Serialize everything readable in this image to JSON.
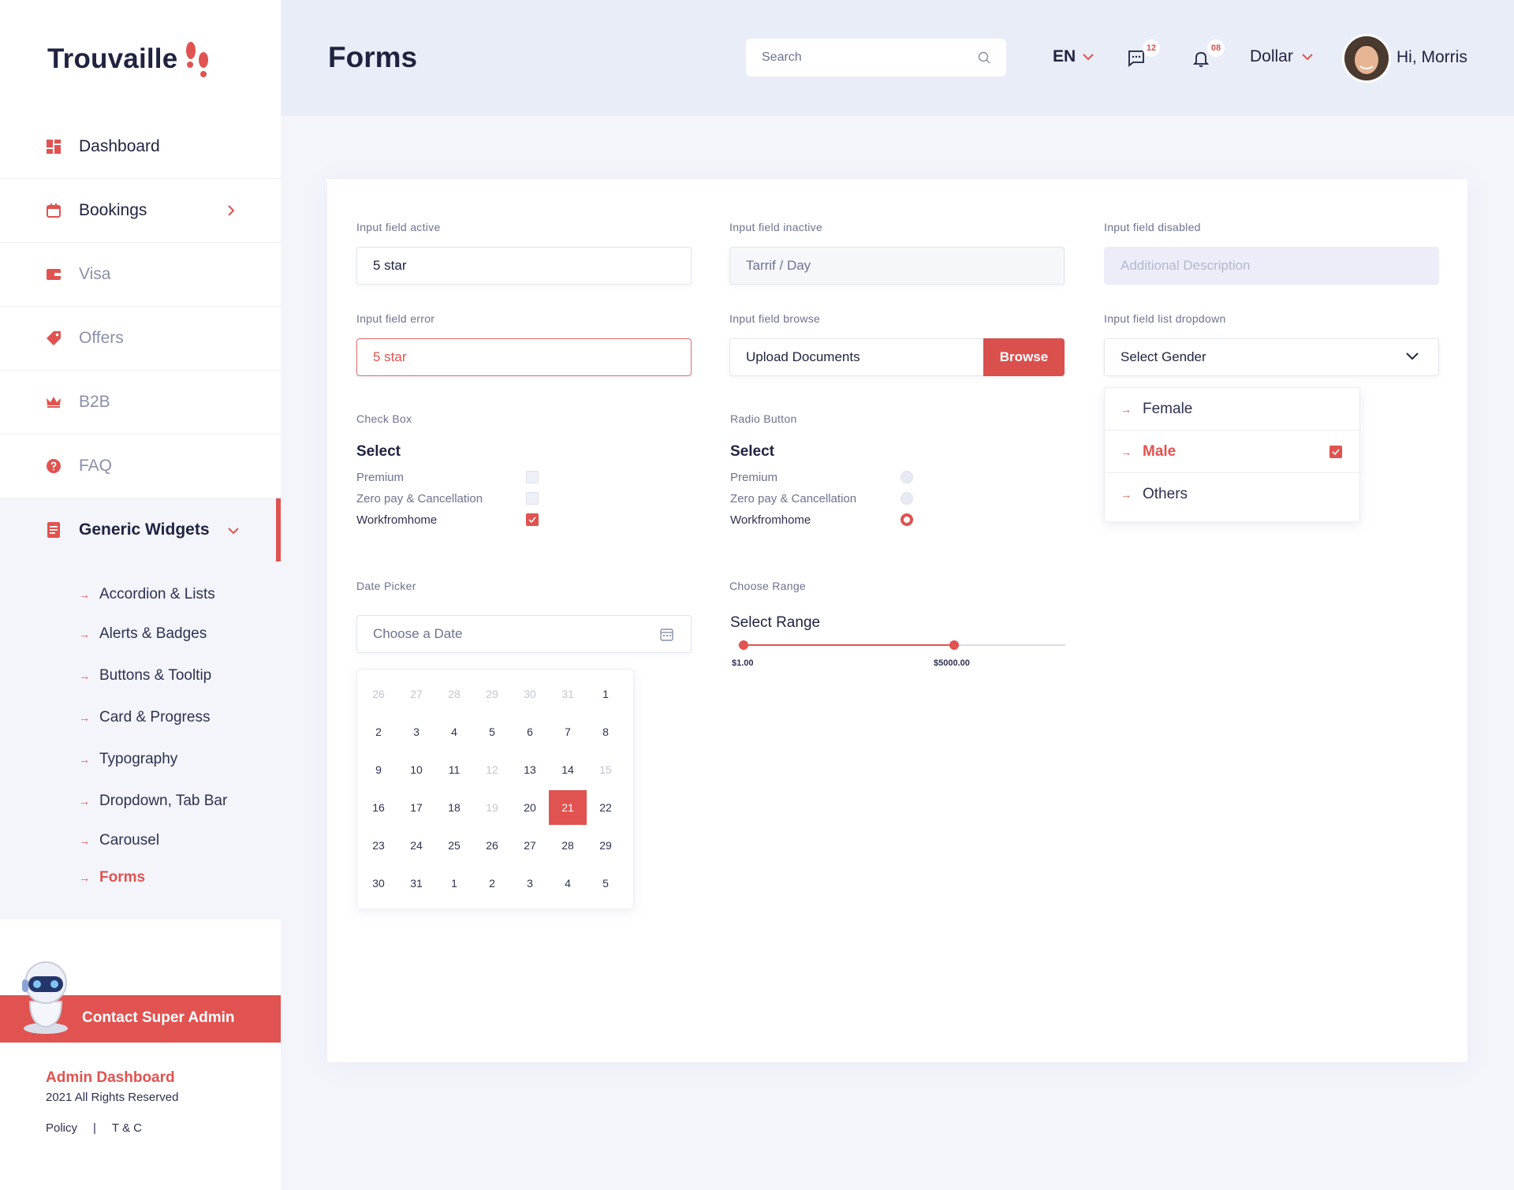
{
  "brand": {
    "name": "Trouvaille",
    "accent": "#e05350"
  },
  "sidebar": {
    "items": [
      {
        "label": "Dashboard",
        "icon": "dashboard-icon"
      },
      {
        "label": "Bookings",
        "icon": "calendar-icon"
      },
      {
        "label": "Visa",
        "icon": "wallet-icon"
      },
      {
        "label": "Offers",
        "icon": "tag-icon"
      },
      {
        "label": "B2B",
        "icon": "crown-icon"
      },
      {
        "label": "FAQ",
        "icon": "question-icon"
      },
      {
        "label": "Generic Widgets",
        "icon": "document-icon"
      }
    ],
    "subitems": [
      "Accordion & Lists",
      "Alerts & Badges",
      "Buttons & Tooltip",
      "Card & Progress",
      "Typography",
      "Dropdown, Tab Bar",
      "Carousel",
      "Forms"
    ],
    "contact": "Contact Super Admin",
    "footer": {
      "title": "Admin Dashboard",
      "copyright": "2021 All Rights Reserved",
      "policy": "Policy",
      "separator": "|",
      "terms": "T & C"
    }
  },
  "header": {
    "title": "Forms",
    "search_placeholder": "Search",
    "language": "EN",
    "messages_count": "12",
    "notifications_count": "08",
    "currency": "Dollar",
    "greeting": "Hi, Morris"
  },
  "form": {
    "active": {
      "label": "Input field active",
      "value": "5 star"
    },
    "inactive": {
      "label": "Input field inactive",
      "value": "Tarrif / Day"
    },
    "disabled": {
      "label": "Input field disabled",
      "placeholder": "Additional Description"
    },
    "error": {
      "label": "Input field error",
      "value": "5 star"
    },
    "browse": {
      "label": "Input field browse",
      "value": "Upload Documents",
      "button": "Browse"
    },
    "dropdown": {
      "label": "Input field list dropdown",
      "value": "Select Gender",
      "options": [
        {
          "label": "Female",
          "selected": false
        },
        {
          "label": "Male",
          "selected": true
        },
        {
          "label": "Others",
          "selected": false
        }
      ]
    },
    "checkbox": {
      "label": "Check Box",
      "title": "Select",
      "options": [
        {
          "label": "Premium",
          "checked": false
        },
        {
          "label": "Zero pay & Cancellation",
          "checked": false
        },
        {
          "label": "Workfromhome",
          "checked": true
        }
      ]
    },
    "radio": {
      "label": "Radio Button",
      "title": "Select",
      "options": [
        {
          "label": "Premium",
          "checked": false
        },
        {
          "label": "Zero pay & Cancellation",
          "checked": false
        },
        {
          "label": "Workfromhome",
          "checked": true
        }
      ]
    },
    "datepicker": {
      "label": "Date Picker",
      "placeholder": "Choose a Date",
      "selected": "21",
      "weeks": [
        [
          "26",
          "27",
          "28",
          "29",
          "30",
          "31",
          "1"
        ],
        [
          "2",
          "3",
          "4",
          "5",
          "6",
          "7",
          "8"
        ],
        [
          "9",
          "10",
          "11",
          "12",
          "13",
          "14",
          "15"
        ],
        [
          "16",
          "17",
          "18",
          "19",
          "20",
          "21",
          "22"
        ],
        [
          "23",
          "24",
          "25",
          "26",
          "27",
          "28",
          "29"
        ],
        [
          "30",
          "31",
          "1",
          "2",
          "3",
          "4",
          "5"
        ]
      ],
      "muted": [
        "0-0",
        "0-1",
        "0-2",
        "0-3",
        "0-4",
        "0-5",
        "2-3",
        "2-6",
        "3-3"
      ]
    },
    "range": {
      "label": "Choose Range",
      "title": "Select Range",
      "min_label": "$1.00",
      "max_label": "$5000.00",
      "low_fraction": 0.02,
      "high_fraction": 0.66
    }
  }
}
